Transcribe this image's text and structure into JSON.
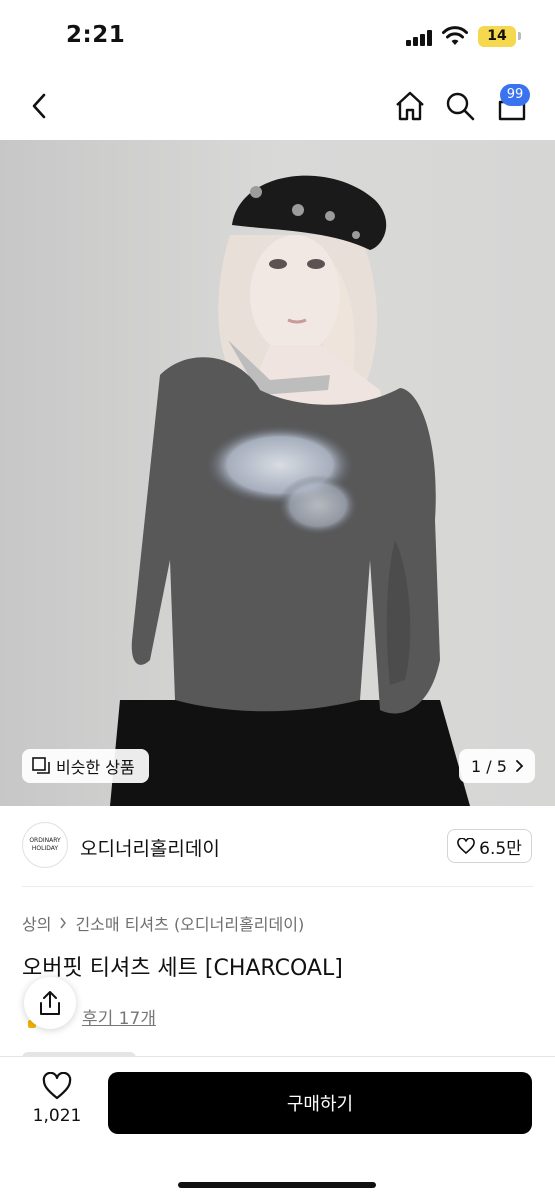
{
  "status_bar": {
    "time": "2:21",
    "battery": "14"
  },
  "header": {
    "icons": [
      "back-chevron-icon",
      "home-icon",
      "search-icon",
      "bag-icon"
    ],
    "cart_badge": "99"
  },
  "gallery": {
    "similar_label": "비슷한 상품",
    "page_indicator": "1 / 5"
  },
  "brand": {
    "logo_line1": "ORDINARY",
    "logo_line2": "HOLIDAY",
    "name": "오디너리홀리데이",
    "likes": "6.5만"
  },
  "breadcrumb": {
    "category": "상의",
    "subcategory": "긴소매 티셔츠 (오디너리홀리데이)"
  },
  "product": {
    "title": "오버핏 티셔츠 세트 [CHARCOAL]",
    "review_link": "후기 17개"
  },
  "bottom_bar": {
    "wish_count": "1,021",
    "buy_label": "구매하기"
  },
  "colors": {
    "badge": "#3a73f0",
    "buy_button": "#000000",
    "battery": "#f5d84e"
  }
}
